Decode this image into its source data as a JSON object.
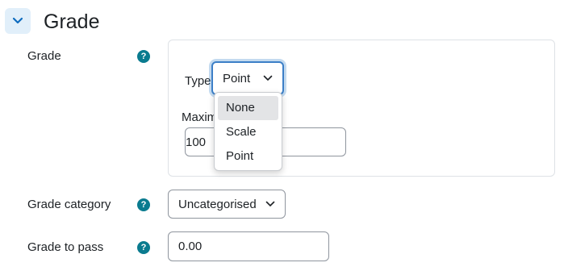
{
  "section": {
    "title": "Grade",
    "collapse_icon": "chevron-down-icon"
  },
  "fields": {
    "grade": {
      "label": "Grade",
      "help_icon": "help-icon",
      "help_glyph": "?"
    },
    "grade_category": {
      "label": "Grade category",
      "help_glyph": "?",
      "value": "Uncategorised"
    },
    "grade_to_pass": {
      "label": "Grade to pass",
      "help_glyph": "?",
      "value": "0.00"
    }
  },
  "grade_group": {
    "type_label": "Type",
    "type_value": "Point",
    "maximum_label": "Maxim",
    "maximum_value": "100"
  },
  "type_dropdown": {
    "options": [
      "None",
      "Scale",
      "Point"
    ],
    "highlighted": "None"
  },
  "colors": {
    "accent": "#0f6cbf",
    "help_icon": "#0a7b8f",
    "collapse_bg": "#e1effa"
  }
}
